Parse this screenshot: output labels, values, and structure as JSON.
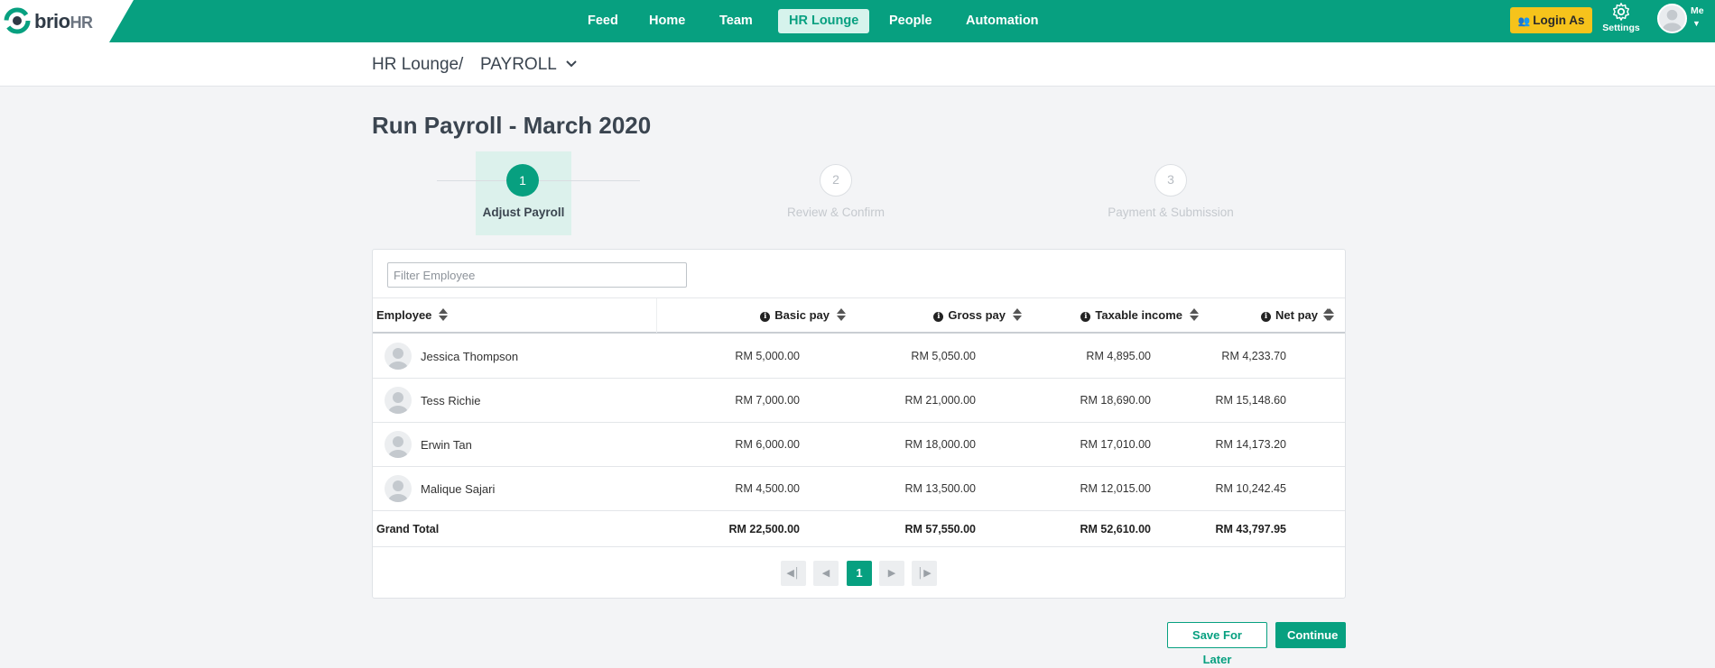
{
  "brand": {
    "name": "brio",
    "suffix": "HR",
    "color": "#07a080"
  },
  "nav": {
    "items": [
      {
        "label": "Feed",
        "active": false
      },
      {
        "label": "Home",
        "active": false
      },
      {
        "label": "Team",
        "active": false
      },
      {
        "label": "HR Lounge",
        "active": true
      },
      {
        "label": "People",
        "active": false
      },
      {
        "label": "Automation",
        "active": false
      }
    ],
    "login_as": "Login As",
    "settings": "Settings",
    "me": "Me"
  },
  "breadcrumb": {
    "root": "HR Lounge",
    "separator": "/",
    "current": "PAYROLL"
  },
  "page": {
    "title": "Run Payroll - March 2020"
  },
  "steps": [
    {
      "number": "1",
      "label": "Adjust Payroll",
      "state": "active"
    },
    {
      "number": "2",
      "label": "Review & Confirm",
      "state": "todo"
    },
    {
      "number": "3",
      "label": "Payment & Submission",
      "state": "todo"
    }
  ],
  "filter": {
    "placeholder": "Filter Employee",
    "value": ""
  },
  "table": {
    "headers": {
      "employee": "Employee",
      "basic_pay": "Basic pay",
      "gross_pay": "Gross pay",
      "taxable_income": "Taxable income",
      "net_pay": "Net pay"
    },
    "rows": [
      {
        "name": "Jessica Thompson",
        "basic_pay": "RM 5,000.00",
        "gross_pay": "RM 5,050.00",
        "taxable_income": "RM 4,895.00",
        "net_pay": "RM 4,233.70"
      },
      {
        "name": "Tess Richie",
        "basic_pay": "RM 7,000.00",
        "gross_pay": "RM 21,000.00",
        "taxable_income": "RM 18,690.00",
        "net_pay": "RM 15,148.60"
      },
      {
        "name": "Erwin Tan",
        "basic_pay": "RM 6,000.00",
        "gross_pay": "RM 18,000.00",
        "taxable_income": "RM 17,010.00",
        "net_pay": "RM 14,173.20"
      },
      {
        "name": "Malique Sajari",
        "basic_pay": "RM 4,500.00",
        "gross_pay": "RM 13,500.00",
        "taxable_income": "RM 12,015.00",
        "net_pay": "RM 10,242.45"
      }
    ],
    "total": {
      "label": "Grand Total",
      "basic_pay": "RM 22,500.00",
      "gross_pay": "RM 57,550.00",
      "taxable_income": "RM 52,610.00",
      "net_pay": "RM 43,797.95"
    }
  },
  "pagination": {
    "first_icon": "first-page-icon",
    "prev_icon": "prev-page-icon",
    "current": "1",
    "next_icon": "next-page-icon",
    "last_icon": "last-page-icon"
  },
  "actions": {
    "save_for_later": "Save For Later",
    "continue": "Continue"
  }
}
